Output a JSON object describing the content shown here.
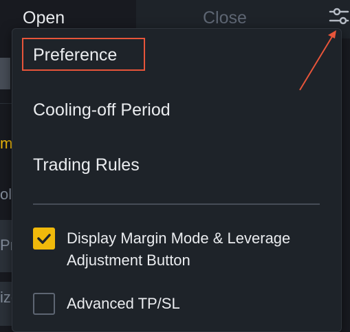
{
  "tabs": {
    "open_label": "Open",
    "close_label": "Close",
    "settings_icon": "settings-sliders-icon"
  },
  "menu": {
    "items": [
      {
        "label": "Preference"
      },
      {
        "label": "Cooling-off Period"
      },
      {
        "label": "Trading Rules"
      }
    ]
  },
  "options": [
    {
      "label_line1": "Display Margin Mode & Leverage",
      "label_line2": "Adjustment Button",
      "checked": true
    },
    {
      "label_line1": "Advanced TP/SL",
      "label_line2": "",
      "checked": false
    }
  ],
  "background_fragments": {
    "fragment_1": "mi",
    "fragment_2": "ol",
    "fragment_3": "Pri",
    "fragment_4": "ize"
  },
  "colors": {
    "accent": "#f0b90b",
    "annotation": "#e8553a",
    "panel": "#1e2329",
    "background": "#181a20"
  }
}
